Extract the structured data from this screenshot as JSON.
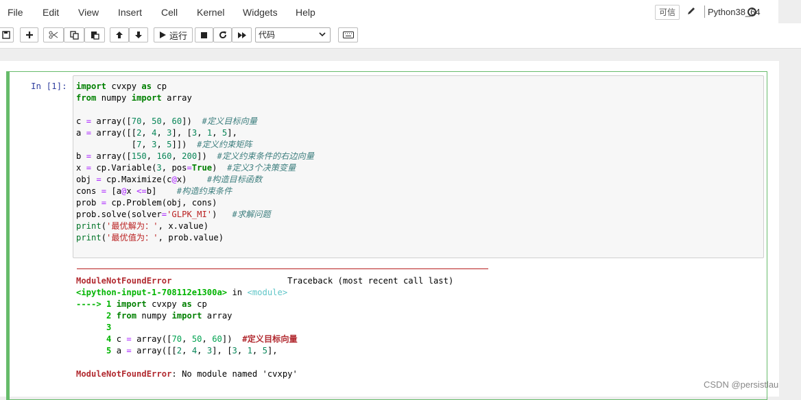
{
  "menubar": {
    "items": [
      "File",
      "Edit",
      "View",
      "Insert",
      "Cell",
      "Kernel",
      "Widgets",
      "Help"
    ],
    "trusted": "可信",
    "kernel_name": "Python38_64"
  },
  "toolbar": {
    "run_label": "运行",
    "cell_type": "代码"
  },
  "cell": {
    "prompt": "In  [1]:"
  },
  "watermark": "CSDN @persistlau"
}
